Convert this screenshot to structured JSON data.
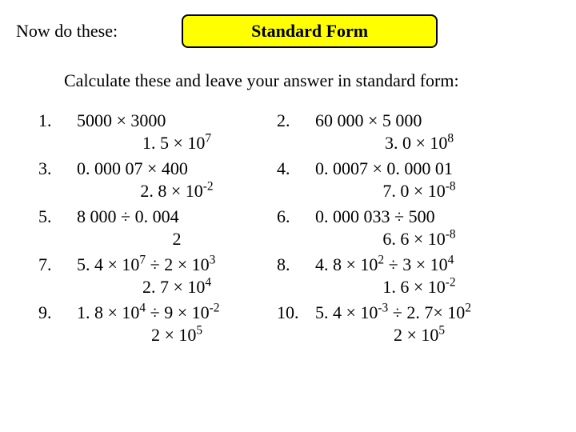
{
  "header": {
    "now_do": "Now do these:",
    "title": "Standard Form"
  },
  "intro": "Calculate these and leave your answer in standard form:",
  "rows": [
    {
      "left": {
        "num": "1.",
        "question": "5000 × 3000",
        "answer_html": "1. 5 × 10<sup>7</sup>"
      },
      "right": {
        "num": "2.",
        "question": "60 000 × 5 000",
        "answer_html": "3. 0 × 10<sup>8</sup>"
      }
    },
    {
      "left": {
        "num": "3.",
        "question": "0. 000 07 × 400",
        "answer_html": "2. 8 × 10<sup>-2</sup>"
      },
      "right": {
        "num": "4.",
        "question": "0. 0007 × 0. 000 01",
        "answer_html": "7. 0 × 10<sup>-8</sup>"
      }
    },
    {
      "left": {
        "num": "5.",
        "question": "8 000 ÷ 0. 004",
        "answer_html": "2"
      },
      "right": {
        "num": "6.",
        "question": "0. 000 033 ÷ 500",
        "answer_html": "6. 6 × 10<sup>-8</sup>"
      }
    },
    {
      "left": {
        "num": "7.",
        "question_html": "5. 4 × 10<sup>7</sup> ÷ 2 × 10<sup>3</sup>",
        "answer_html": "2. 7 × 10<sup>4</sup>"
      },
      "right": {
        "num": "8.",
        "question_html": "4. 8 × 10<sup>2</sup> ÷ 3 × 10<sup>4</sup>",
        "answer_html": "1. 6 × 10<sup>-2</sup>"
      }
    },
    {
      "left": {
        "num": "9.",
        "question_html": "1. 8 × 10<sup>4</sup> ÷ 9 × 10<sup>-2</sup>",
        "answer_html": "2 × 10<sup>5</sup>"
      },
      "right": {
        "num": "10.",
        "question_html": "5. 4 × 10<sup>-3</sup> ÷ 2. 7× 10<sup>2</sup>",
        "answer_html": "2 × 10<sup>5</sup>"
      }
    }
  ]
}
